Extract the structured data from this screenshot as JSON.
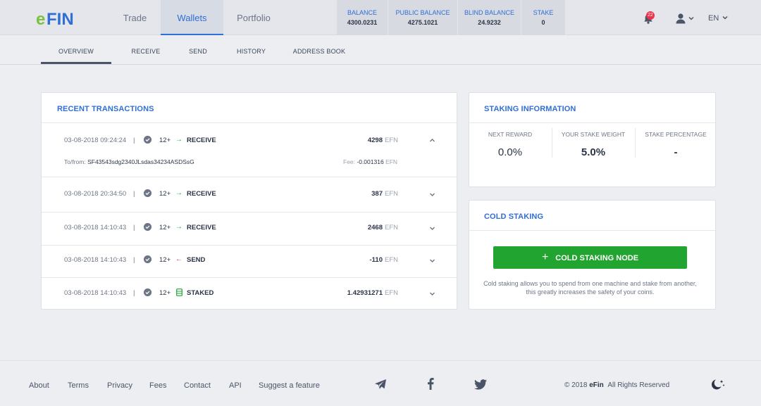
{
  "app": {
    "logo_text": "eFIN",
    "brand_colors": {
      "e": "#7ac142",
      "fin": "#2f6fd6"
    }
  },
  "header": {
    "tabs": [
      {
        "label": "Trade",
        "active": false
      },
      {
        "label": "Wallets",
        "active": true
      },
      {
        "label": "Portfolio",
        "active": false
      }
    ],
    "balances": [
      {
        "label": "BALANCE",
        "value": "4300.0231"
      },
      {
        "label": "PUBLIC BALANCE",
        "value": "4275.1021"
      },
      {
        "label": "BLIND BALANCE",
        "value": "24.9232"
      },
      {
        "label": "STAKE",
        "value": "0"
      }
    ],
    "notifications_count": "22",
    "language": "EN",
    "icons": [
      "bell-icon",
      "user-icon",
      "chevron-down-icon"
    ]
  },
  "subnav": {
    "tabs": [
      {
        "label": "OVERVIEW",
        "active": true
      },
      {
        "label": "RECEIVE",
        "active": false
      },
      {
        "label": "SEND",
        "active": false
      },
      {
        "label": "HISTORY",
        "active": false
      },
      {
        "label": "ADDRESS BOOK",
        "active": false
      }
    ]
  },
  "recent": {
    "title": "RECENT TRANSACTIONS",
    "rows": [
      {
        "date": "03-08-2018 09:24:24",
        "confirmations": "12+",
        "direction_icon": "arrow-right-icon",
        "type": "RECEIVE",
        "amount": "4298",
        "unit": "EFN",
        "expanded": true,
        "to_from_label": "To/from:",
        "to_from": "SF43543sdg2340JLsdas34234ASDSsG",
        "fee_label": "Fee:",
        "fee": "-0.001316",
        "fee_unit": "EFN"
      },
      {
        "date": "03-08-2018 20:34:50",
        "confirmations": "12+",
        "direction_icon": "arrow-right-icon",
        "type": "RECEIVE",
        "amount": "387",
        "unit": "EFN",
        "expanded": false
      },
      {
        "date": "03-08-2018 14:10:43",
        "confirmations": "12+",
        "direction_icon": "arrow-right-icon",
        "type": "RECEIVE",
        "amount": "2468",
        "unit": "EFN",
        "expanded": false
      },
      {
        "date": "03-08-2018 14:10:43",
        "confirmations": "12+",
        "direction_icon": "arrow-left-icon",
        "type": "SEND",
        "amount": "-110",
        "unit": "EFN",
        "expanded": false
      },
      {
        "date": "03-08-2018 14:10:43",
        "confirmations": "12+",
        "direction_icon": "coins-icon",
        "type": "STAKED",
        "amount": "1.42931271",
        "unit": "EFN",
        "expanded": false
      }
    ]
  },
  "staking": {
    "title": "STAKING INFORMATION",
    "stats": [
      {
        "label": "NEXT REWARD",
        "value": "0.0%"
      },
      {
        "label": "YOUR STAKE WEIGHT",
        "value": "5.0%"
      },
      {
        "label": "STAKE PERCENTAGE",
        "value": "-"
      }
    ]
  },
  "cold_staking": {
    "title": "COLD STAKING",
    "button_label": "COLD STAKING NODE",
    "description": "Cold staking allows you to spend from one machine and stake from another, this greatly increases the safety of your coins.",
    "button_color": "#22a431"
  },
  "footer": {
    "links": [
      "About",
      "Terms",
      "Privacy",
      "Fees",
      "Contact",
      "API",
      "Suggest a feature"
    ],
    "social_icons": [
      "telegram-icon",
      "facebook-icon",
      "twitter-icon"
    ],
    "copyright_prefix": "© 2018",
    "copyright_brand": "eFin",
    "copyright_suffix": "All Rights Reserved",
    "theme_icon": "moon-stars-icon"
  }
}
